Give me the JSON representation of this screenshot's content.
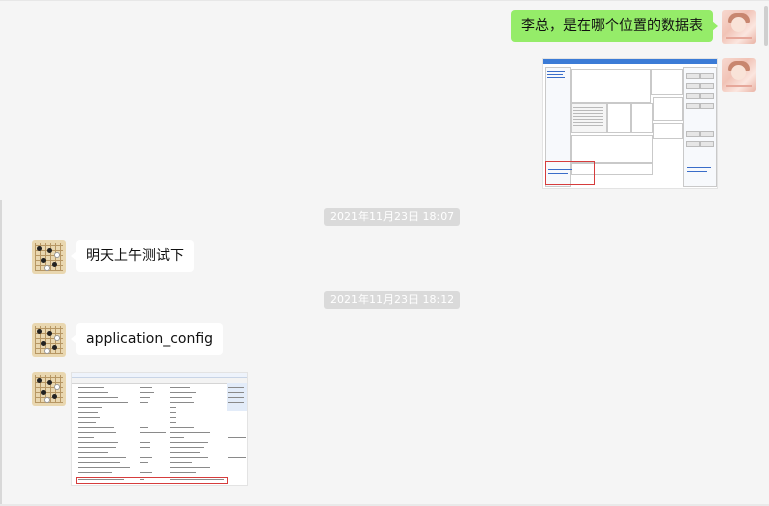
{
  "messages": {
    "sent_text": "李总，是在哪个位置的数据表",
    "timestamp_1": "2021年11月23日 18:07",
    "reply_1": "明天上午测试下",
    "timestamp_2": "2021年11月23日 18:12",
    "reply_2": "application_config"
  },
  "colors": {
    "chat_background": "#f5f5f5",
    "sent_bubble": "#95ec69",
    "received_bubble": "#ffffff",
    "timestamp_badge": "#dadada",
    "highlight_box": "#d63c3c"
  },
  "images": {
    "sent_screenshot": "app-window-screenshot",
    "received_screenshot": "database-table-screenshot"
  }
}
